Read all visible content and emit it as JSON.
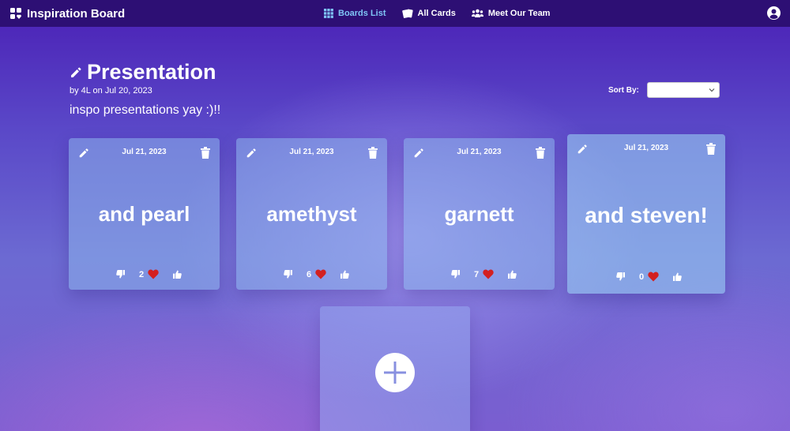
{
  "app": {
    "title": "Inspiration Board"
  },
  "nav": {
    "links": [
      {
        "label": "Boards List",
        "icon": "grid-icon",
        "active": true
      },
      {
        "label": "All Cards",
        "icon": "cards-icon",
        "active": false
      },
      {
        "label": "Meet Our Team",
        "icon": "team-icon",
        "active": false
      }
    ]
  },
  "board": {
    "title": "Presentation",
    "meta": "by 4L on Jul 20, 2023",
    "description": "inspo presentations yay :)!!"
  },
  "sort": {
    "label": "Sort By:",
    "selected": ""
  },
  "cards": [
    {
      "date": "Jul 21, 2023",
      "message": "and pearl",
      "likes": "2"
    },
    {
      "date": "Jul 21, 2023",
      "message": "amethyst",
      "likes": "6"
    },
    {
      "date": "Jul 21, 2023",
      "message": "garnett",
      "likes": "7"
    },
    {
      "date": "Jul 21, 2023",
      "message": "and steven!",
      "likes": "0"
    }
  ],
  "colors": {
    "navbar": "#2d0f74",
    "active_link": "#7fc4f5",
    "heart": "#d32020"
  }
}
